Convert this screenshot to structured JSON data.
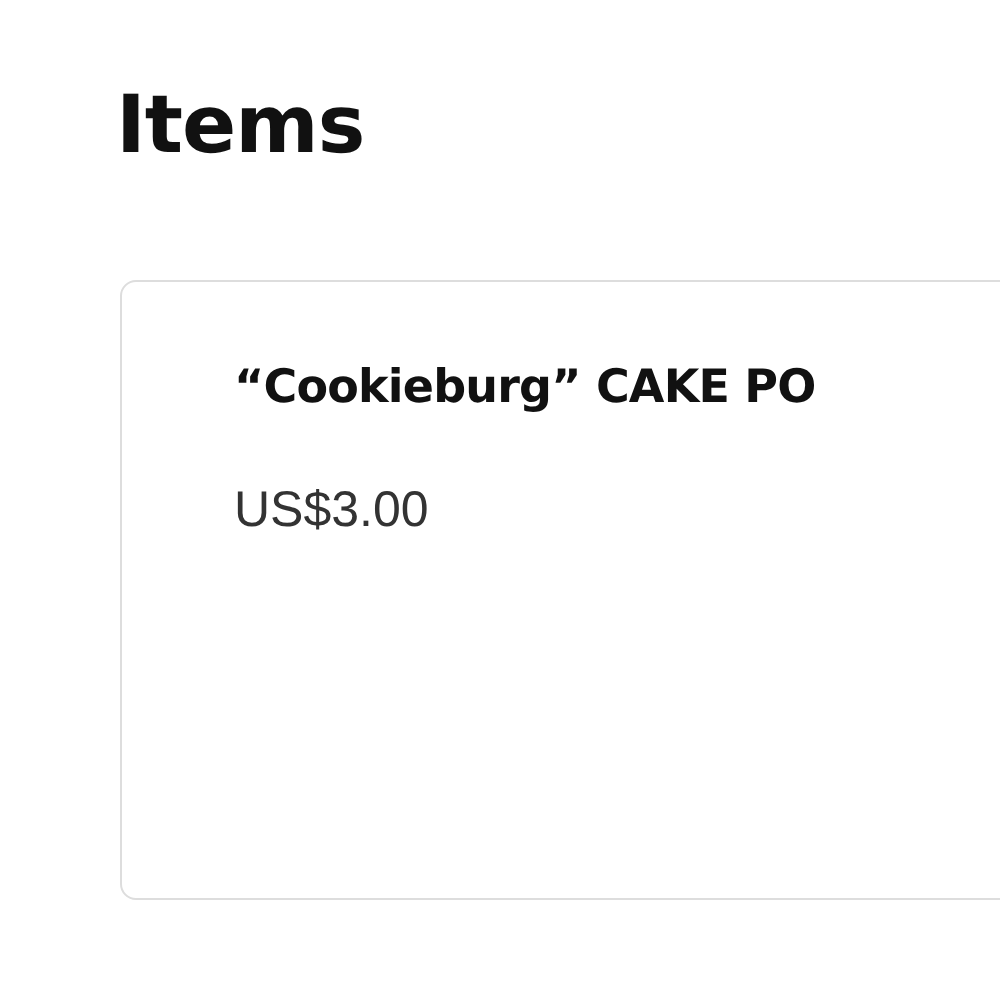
{
  "heading": "Items",
  "items": [
    {
      "title": "“Cookieburg” CAKE PO",
      "price": "US$3.00"
    }
  ]
}
